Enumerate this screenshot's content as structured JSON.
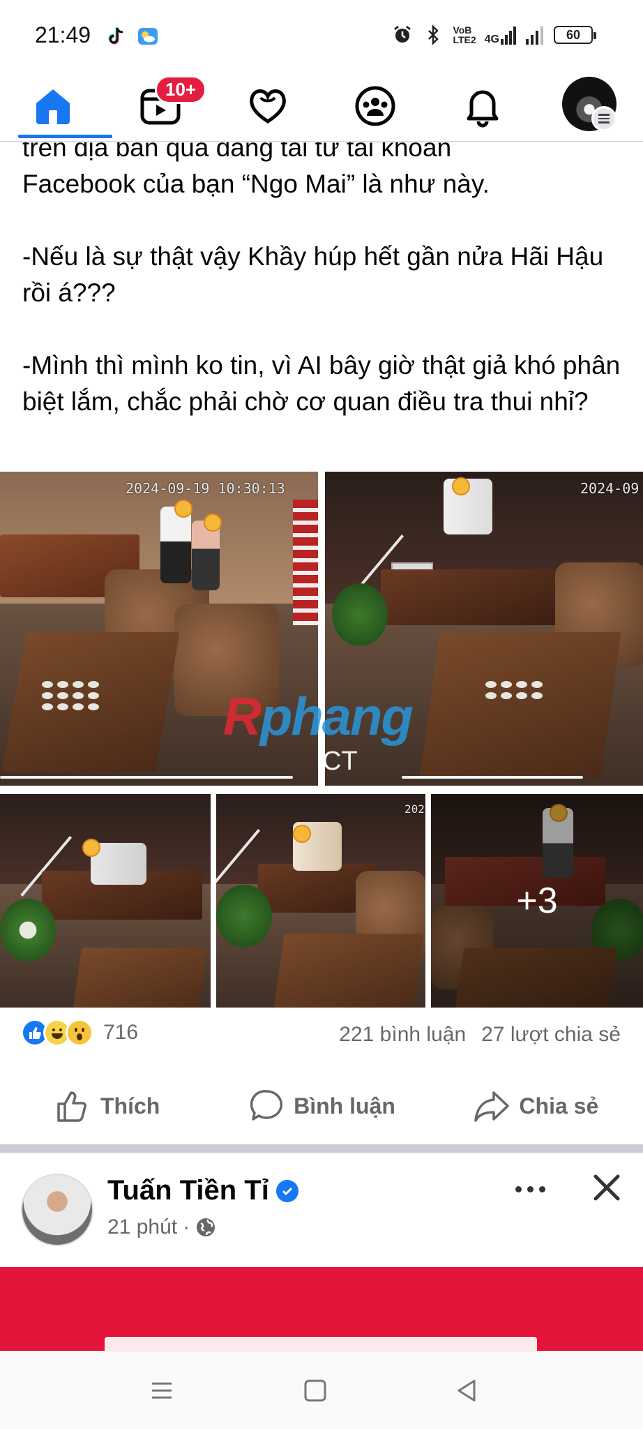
{
  "status_bar": {
    "time": "21:49",
    "left_icons": [
      "tiktok-icon",
      "weather-icon"
    ],
    "right_icons": [
      "alarm-icon",
      "bluetooth-icon",
      "volte-icon",
      "4g-signal-icon",
      "signal-icon"
    ],
    "volte_label_top": "VoB",
    "volte_label_bottom": "LTE2",
    "network_label": "4G",
    "battery": "60"
  },
  "nav": {
    "items": [
      {
        "name": "home-icon",
        "active": true
      },
      {
        "name": "video-icon",
        "badge": "10+"
      },
      {
        "name": "dating-heart-icon"
      },
      {
        "name": "groups-icon"
      },
      {
        "name": "notifications-bell-icon"
      },
      {
        "name": "profile-avatar"
      }
    ],
    "video_badge": "10+",
    "accent_color": "#1877f2"
  },
  "post": {
    "text_partial_top": "trên địa bàn quá đăng tải từ tài khoản",
    "text_lines": [
      "Facebook của bạn “Ngo Mai” là như này.",
      "",
      "-Nếu là sự thật vậy Khầy húp hết gần nửa Hãi Hậu rồi á???",
      "",
      "-Mình thì mình ko tin, vì AI bây giờ thật giả khó phân biệt lắm, chắc phải chờ cơ quan điều tra thui nhỉ?"
    ],
    "photos": {
      "timestamp_1": "2024-09-19 10:30:13",
      "timestamp_2": "2024-09",
      "timestamp_4": "202",
      "watermark_first": "R",
      "watermark_rest": "phang",
      "ct_label": "CT",
      "more_count": "+3"
    },
    "reactions": {
      "types": [
        "like",
        "haha",
        "wow"
      ],
      "count": "716",
      "comments": "221 bình luận",
      "shares": "27 lượt chia sẻ"
    },
    "actions": {
      "like": "Thích",
      "comment": "Bình luận",
      "share": "Chia sẻ"
    }
  },
  "next_post": {
    "author": "Tuấn Tiền Tỉ",
    "verified": true,
    "time": "21 phút",
    "separator": "·",
    "audience": "public-globe-icon",
    "banner_color": "#e4153a"
  },
  "system_nav": [
    "recents-menu-icon",
    "home-square-icon",
    "back-triangle-icon"
  ]
}
